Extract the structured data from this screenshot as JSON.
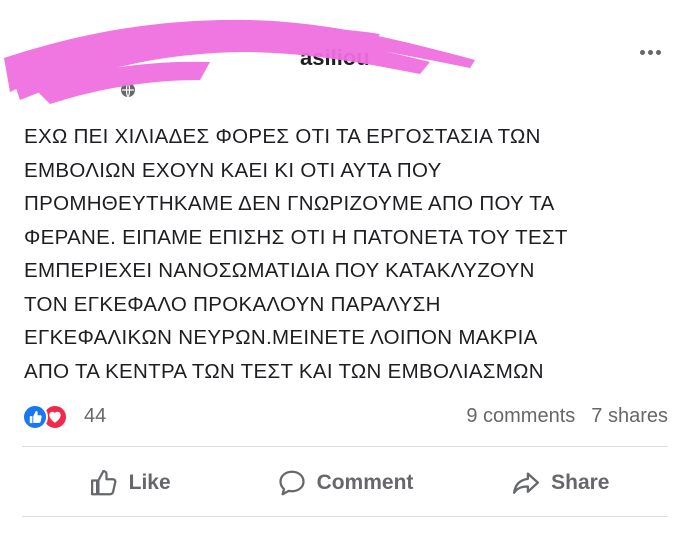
{
  "post": {
    "author_visible": "asiliou",
    "text_lines": [
      "ΕΧΩ ΠΕΙ ΧΙΛΙΑΔΕΣ ΦΟΡΕΣ ΟΤΙ  ΤΑ ΕΡΓΟΣΤΑΣΙΑ ΤΩΝ",
      "ΕΜΒΟΛΙΩΝ ΕΧΟΥΝ ΚΑΕΙ ΚΙ ΟΤΙ ΑΥΤΑ ΠΟΥ",
      "ΠΡΟΜΗΘΕΥΤΗΚΑΜΕ  ΔΕΝ ΓΝΩΡΙΖΟΥΜΕ ΑΠΟ ΠΟΥ ΤΑ",
      "ΦΕΡΑΝΕ. ΕΙΠΑΜΕ ΕΠΙΣΗΣ ΟΤΙ Η ΠΑΤΟΝΕΤΑ ΤΟΥ ΤΕΣΤ",
      "ΕΜΠΕΡΙΕΧΕΙ ΝΑΝΟΣΩΜΑΤΙΔΙΑ ΠΟΥ ΚΑΤΑΚΛΥΖΟΥΝ",
      "ΤΟΝ ΕΓΚΕΦΑΛΟ ΠΡΟΚΑΛΟΥΝ ΠΑΡΑΛΥΣΗ",
      "ΕΓΚΕΦΑΛΙΚΩΝ ΝΕΥΡΩΝ.ΜΕΙΝΕΤΕ ΛΟΙΠΟΝ  ΜΑΚΡΙΑ",
      "ΑΠΟ ΤΑ ΚΕΝΤΡΑ  ΤΩΝ ΤΕΣΤ ΚΑΙ ΤΩΝ ΕΜΒΟΛΙΑΣΜΩΝ"
    ],
    "icons": {
      "privacy": "globe-icon",
      "menu": "more-options-icon",
      "reaction_like": "thumbs-up-icon",
      "reaction_love": "heart-icon"
    }
  },
  "stats": {
    "reactions": "44",
    "comments": "9 comments",
    "shares": "7 shares"
  },
  "actions": {
    "like": "Like",
    "comment": "Comment",
    "share": "Share"
  },
  "colors": {
    "redaction": "#f06fe0",
    "like_blue": "#1877f2",
    "love_red": "#f0284a",
    "muted": "#65676b"
  }
}
